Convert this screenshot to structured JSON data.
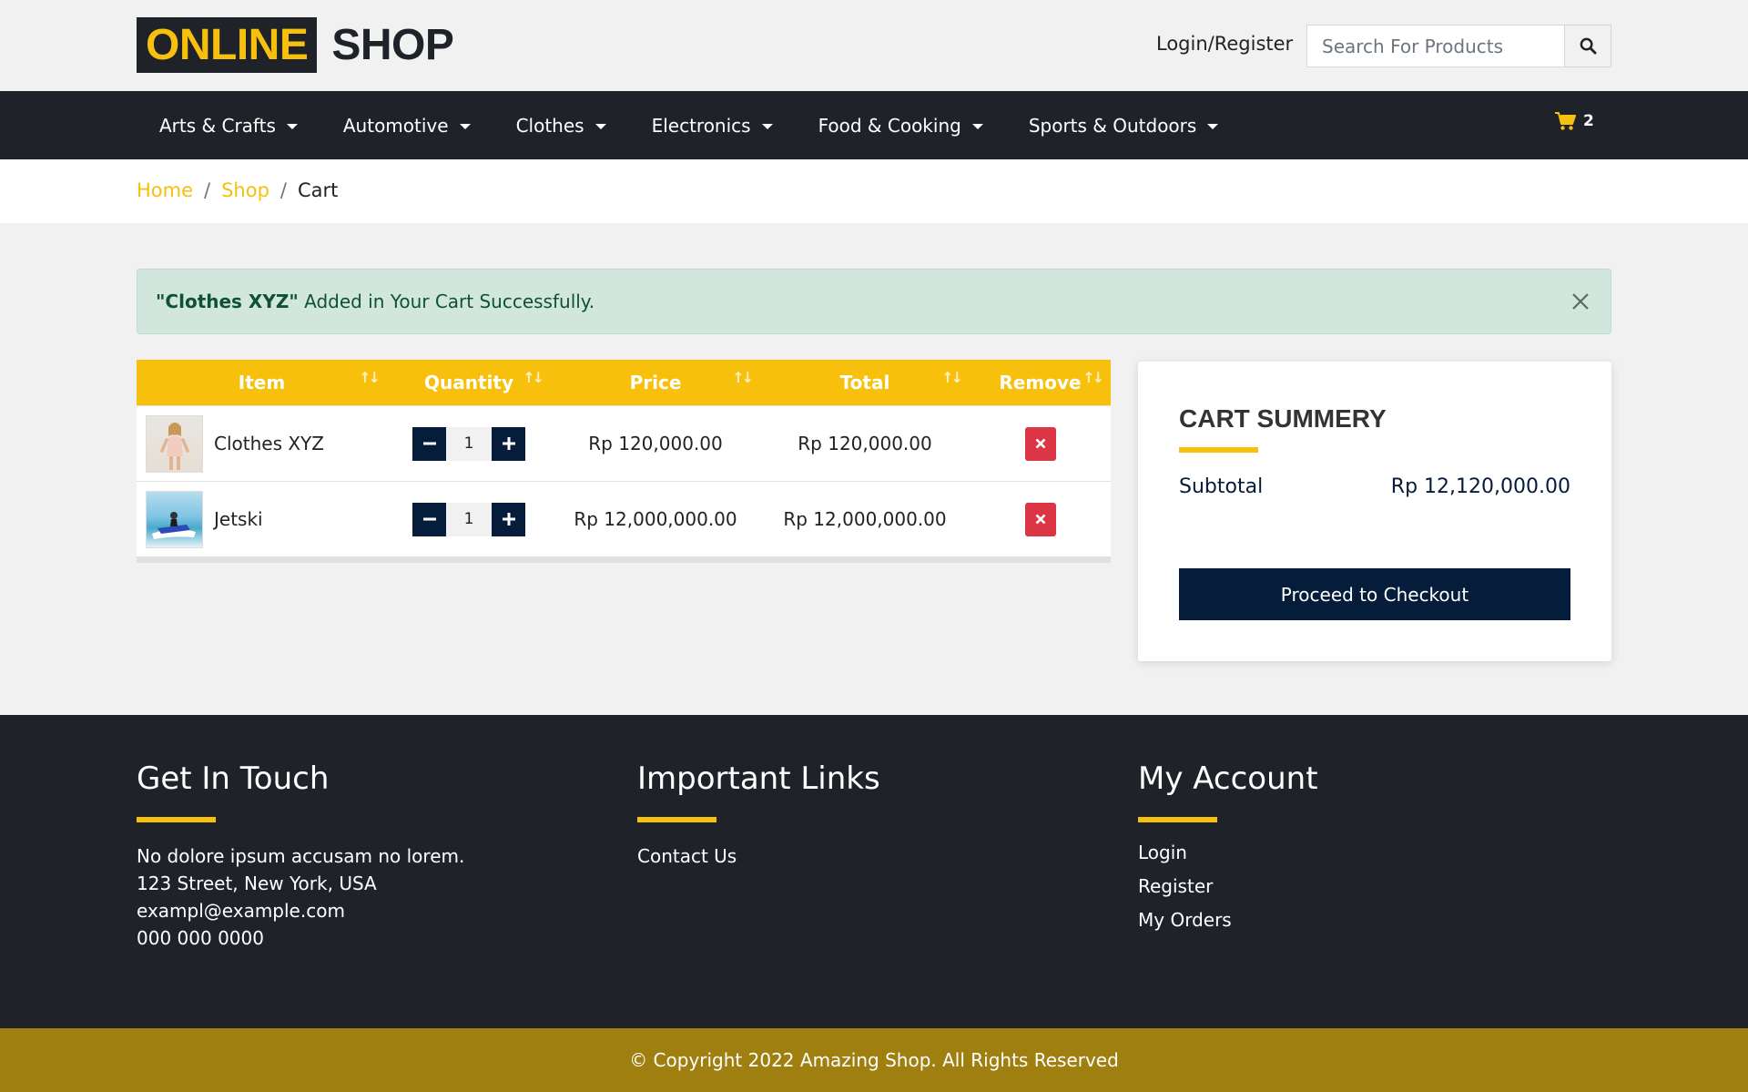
{
  "header": {
    "logo_part1": "ONLINE",
    "logo_part2": "SHOP",
    "login_label": "Login/Register",
    "search_placeholder": "Search For Products"
  },
  "nav": {
    "items": [
      {
        "label": "Arts & Crafts"
      },
      {
        "label": "Automotive"
      },
      {
        "label": "Clothes"
      },
      {
        "label": "Electronics"
      },
      {
        "label": "Food & Cooking"
      },
      {
        "label": "Sports & Outdoors"
      }
    ],
    "cart_count": "2"
  },
  "breadcrumb": {
    "home": "Home",
    "shop": "Shop",
    "current": "Cart"
  },
  "alert": {
    "product": "\"Clothes XYZ\"",
    "message": " Added in Your Cart Successfully."
  },
  "cart": {
    "headers": {
      "item": "Item",
      "quantity": "Quantity",
      "price": "Price",
      "total": "Total",
      "remove": "Remove"
    },
    "rows": [
      {
        "name": "Clothes XYZ",
        "qty": "1",
        "price": "Rp 120,000.00",
        "total": "Rp 120,000.00"
      },
      {
        "name": "Jetski",
        "qty": "1",
        "price": "Rp 12,000,000.00",
        "total": "Rp 12,000,000.00"
      }
    ]
  },
  "summary": {
    "title": "CART SUMMERY",
    "subtotal_label": "Subtotal",
    "subtotal_value": "Rp 12,120,000.00",
    "checkout_label": "Proceed to Checkout"
  },
  "footer": {
    "contact": {
      "title": "Get In Touch",
      "lines": [
        "No dolore ipsum accusam no lorem.",
        "123 Street, New York, USA",
        "exampl@example.com",
        "000 000 0000"
      ]
    },
    "links": {
      "title": "Important Links",
      "items": [
        "Contact Us"
      ]
    },
    "account": {
      "title": "My Account",
      "items": [
        "Login",
        "Register",
        "My Orders"
      ]
    },
    "copyright": "© Copyright 2022 Amazing Shop. All Rights Reserved"
  },
  "colors": {
    "accent": "#f6c00c",
    "dark": "#1f2329",
    "navy": "#051c3b",
    "danger": "#dc3545",
    "footer_bottom": "#9f7f0f"
  }
}
